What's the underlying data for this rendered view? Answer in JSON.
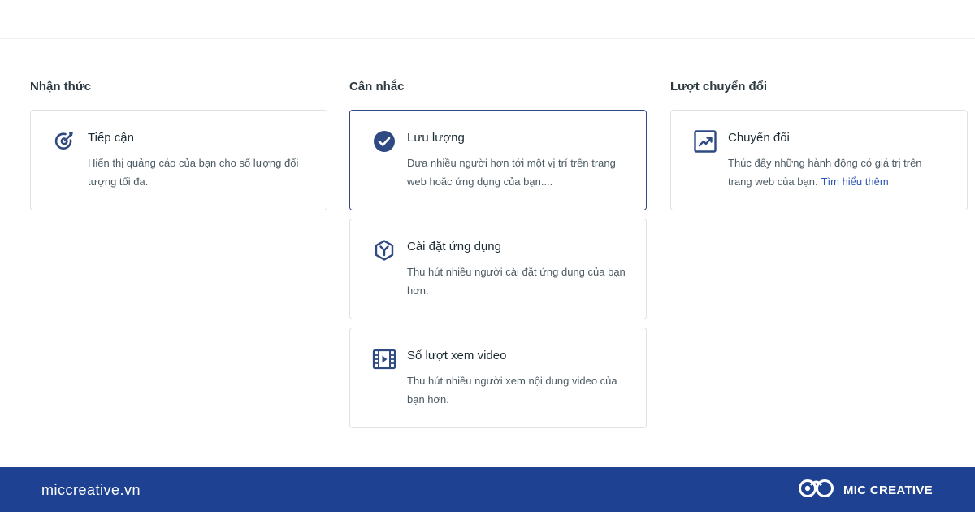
{
  "columns": [
    {
      "title": "Nhận thức",
      "cards": [
        {
          "icon": "target-icon",
          "title": "Tiếp cận",
          "description": "Hiển thị quảng cáo của bạn cho số lượng đối tượng tối đa."
        }
      ]
    },
    {
      "title": "Cân nhắc",
      "cards": [
        {
          "icon": "check-circle-icon",
          "title": "Lưu lượng",
          "description": "Đưa nhiều người hơn tới một vị trí trên trang web hoặc ứng dụng của bạn....",
          "selected": true
        },
        {
          "icon": "app-install-icon",
          "title": "Cài đặt ứng dụng",
          "description": "Thu hút nhiều người cài đặt ứng dụng của bạn hơn."
        },
        {
          "icon": "video-icon",
          "title": "Số lượt xem video",
          "description": "Thu hút nhiều người xem nội dung video của bạn hơn."
        }
      ]
    },
    {
      "title": "Lượt chuyển đổi",
      "cards": [
        {
          "icon": "trend-chart-icon",
          "title": "Chuyển đổi",
          "description": "Thúc đẩy những hành động có giá trị trên trang web của bạn.",
          "link": "Tìm hiểu thêm"
        }
      ]
    }
  ],
  "footer": {
    "url": "miccreative.vn",
    "brand": "MIC CREATIVE"
  },
  "colors": {
    "accent": "#2f4a82",
    "footer_bg": "#1e4291",
    "link": "#2c54b4"
  }
}
